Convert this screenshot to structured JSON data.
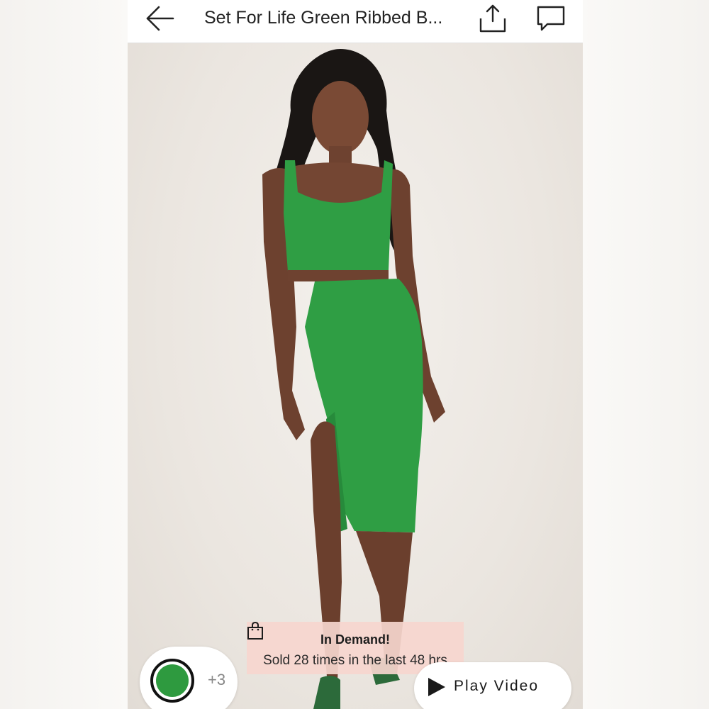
{
  "header": {
    "title": "Set For Life Green Ribbed B...",
    "back_icon": "arrow-left-icon",
    "share_icon": "share-upload-icon",
    "chat_icon": "chat-bubble-icon"
  },
  "product_image": {
    "alt": "Model wearing green ribbed crop top and midi skirt set",
    "garment_color": "#2f9e44"
  },
  "demand_badge": {
    "icon": "shopping-bag-icon",
    "title": "In Demand!",
    "subtitle": "Sold 28 times in the last 48 hrs"
  },
  "color_selector": {
    "selected_color": "#2e9a3f",
    "more_label": "+3"
  },
  "video_button": {
    "icon": "play-icon",
    "label": "Play Video"
  }
}
